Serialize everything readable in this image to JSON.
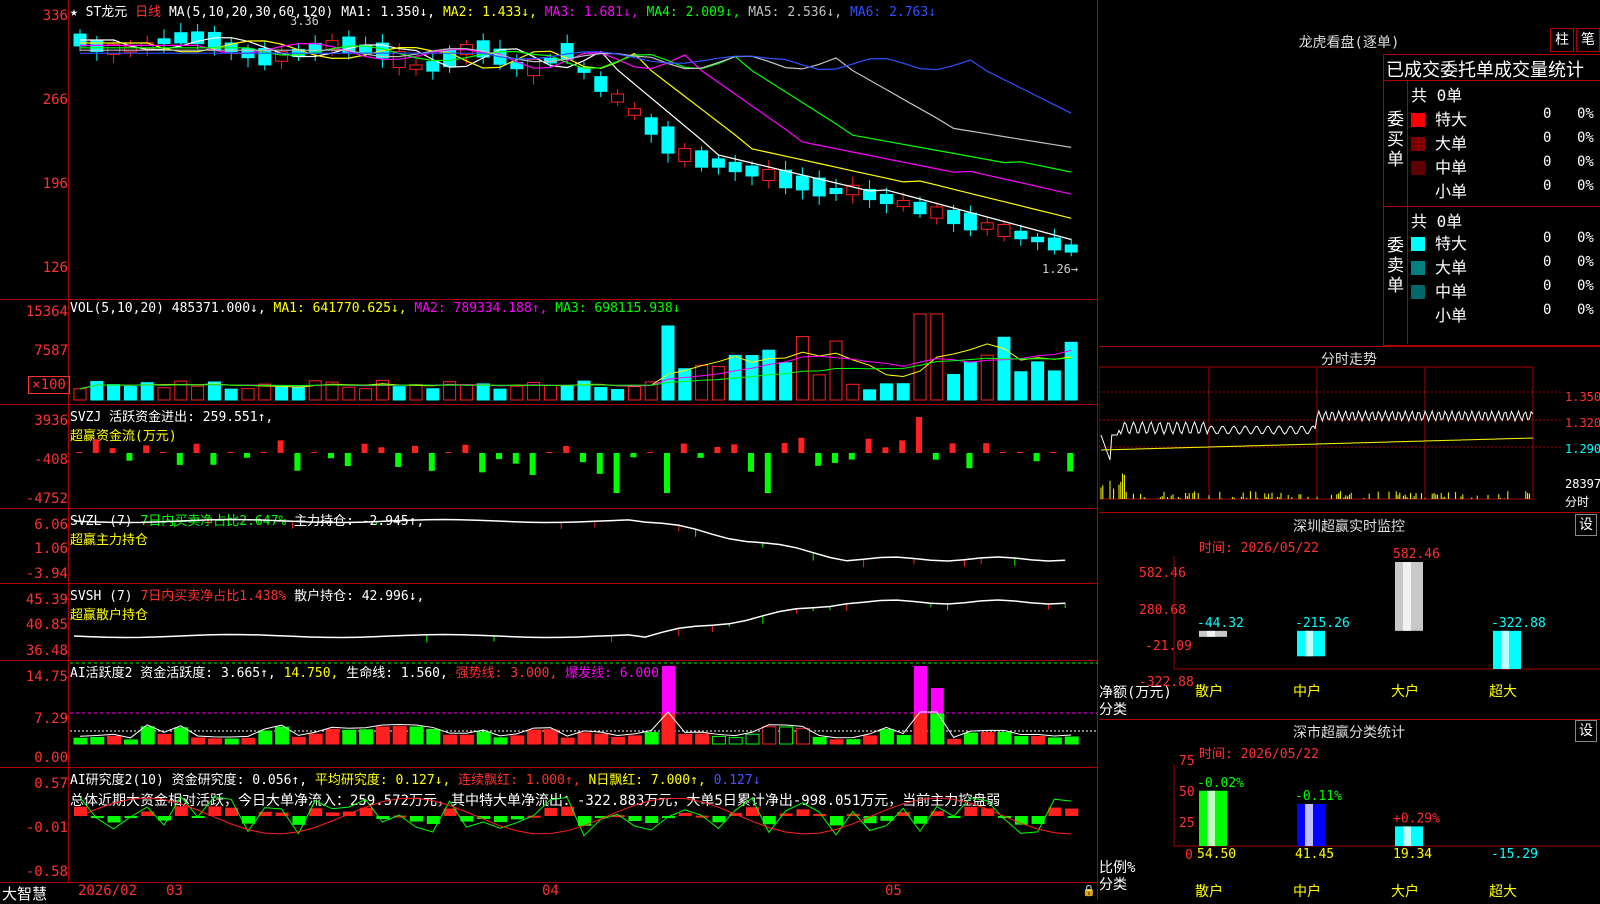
{
  "colors": {
    "up": "#ff2020",
    "down": "#00ffff",
    "bg": "#000000",
    "grid": "#a00000",
    "ma1": "#ffffff",
    "ma2": "#ffff00",
    "ma3": "#ff00ff",
    "ma4": "#00ff00",
    "ma5": "#c0c0c0",
    "ma6": "#3050ff"
  },
  "kline": {
    "title": "★ ST龙元",
    "period": "日线",
    "ma_label": "MA(5,10,20,30,60,120)",
    "ma1": "MA1: 1.350↓,",
    "ma2": "MA2: 1.433↓,",
    "ma3": "MA3: 1.681↓,",
    "ma4": "MA4: 2.009↓,",
    "ma5": "MA5: 2.536↓,",
    "ma6": "MA6: 2.763↓",
    "yticks": [
      "336",
      "266",
      "196",
      "126"
    ],
    "top_mark": "3.36",
    "low_mark": "1.26→"
  },
  "vol": {
    "label": "VOL(5,10,20)",
    "value": "485371.000↓,",
    "ma1": "MA1: 641770.625↓,",
    "ma2": "MA2: 789334.188↑,",
    "ma3": "MA3: 698115.938↓",
    "yticks": [
      "15364",
      "7587",
      "×100"
    ]
  },
  "svzj": {
    "label": "SVZJ  活跃资金进出: 259.551↑,",
    "sub": "超赢资金流(万元)",
    "yticks": [
      "3936",
      "-408",
      "-4752"
    ]
  },
  "svzl": {
    "label": "SVZL (7)",
    "ratio": "7日内买卖净占比2.647%",
    "main": "主力持仓: -2.945↑,",
    "sub": "超赢主力持仓",
    "yticks": [
      "6.06",
      "1.06",
      "-3.94"
    ]
  },
  "svsh": {
    "label": "SVSH (7)",
    "ratio": "7日内买卖净占比1.438%",
    "main": "散户持仓: 42.996↓,",
    "sub": "超赢散户持仓",
    "yticks": [
      "45.39",
      "40.85",
      "36.48"
    ]
  },
  "ai1": {
    "label": "AI活跃度2 资金活跃度: 3.665↑,",
    "v2": "14.750,",
    "life": "生命线: 1.560,",
    "strong": "强势线: 3.000,",
    "burst": "爆发线: 6.000,",
    "yticks": [
      "14.75",
      "7.29",
      "0.00"
    ]
  },
  "ai2": {
    "label": "AI研究度2(10) 资金研究度: 0.056↑,",
    "avg": "平均研究度: 0.127↓,",
    "cont": "连续飘红: 1.000↑,",
    "nday": "N日飘红: 7.000↑,",
    "last": "0.127↓",
    "summary": "总体近期大资金相对活跃，今日大单净流入：259.572万元，其中特大单净流出：-322.883万元，大单5日累计净出-998.051万元，当前主力控盘弱",
    "yticks": [
      "0.57",
      "-0.01",
      "-0.58"
    ]
  },
  "footer": {
    "brand": "大智慧",
    "dates": [
      "2026/02",
      "03",
      "04",
      "05"
    ]
  },
  "right": {
    "title": "龙虎看盘(逐单)",
    "btn1": "柱",
    "btn2": "笔",
    "table_title": "已成交委托单成交量统计",
    "buy_label": "委买单",
    "sell_label": "委卖单",
    "total": "共 0单",
    "rows": [
      {
        "name": "特大",
        "val": "0",
        "pct": "0%"
      },
      {
        "name": "大单",
        "val": "0",
        "pct": "0%"
      },
      {
        "name": "中单",
        "val": "0",
        "pct": "0%"
      },
      {
        "name": "小单",
        "val": "0",
        "pct": "0%"
      }
    ],
    "minute_title": "分时走势",
    "minute_prices": [
      "1.350",
      "1.320",
      "1.290"
    ],
    "minute_vol": "28397",
    "minute_unit": "分时",
    "monitor_title": "深圳超赢实时监控",
    "monitor_time": "时间: 2026/05/22",
    "monitor_yticks": [
      "582.46",
      "280.68",
      "-21.09",
      "-322.88"
    ],
    "monitor_ylabel": "净额(万元)",
    "monitor_xlabel": "分类",
    "stats_title": "深市超赢分类统计",
    "stats_time": "时间: 2026/05/22",
    "stats_yticks": [
      "75",
      "50",
      "25",
      "0"
    ],
    "stats_ylabel": "比例%",
    "stats_xlabel": "分类",
    "set": "设"
  },
  "chart_data": [
    {
      "type": "bar",
      "title": "深圳超赢实时监控",
      "ylabel": "净额(万元)",
      "xlabel": "分类",
      "categories": [
        "散户",
        "中户",
        "大户",
        "超大"
      ],
      "values": [
        -44.32,
        -215.26,
        582.46,
        -322.88
      ],
      "ylim": [
        -322.88,
        582.46
      ]
    },
    {
      "type": "bar",
      "title": "深市超赢分类统计",
      "ylabel": "比例%",
      "xlabel": "分类",
      "categories": [
        "散户",
        "中户",
        "大户",
        "超大"
      ],
      "values": [
        54.5,
        41.45,
        19.34,
        -15.29
      ],
      "change_labels": [
        "-0.02%",
        "-0.11%",
        "+0.29%",
        ""
      ],
      "ylim": [
        0,
        75
      ]
    }
  ]
}
